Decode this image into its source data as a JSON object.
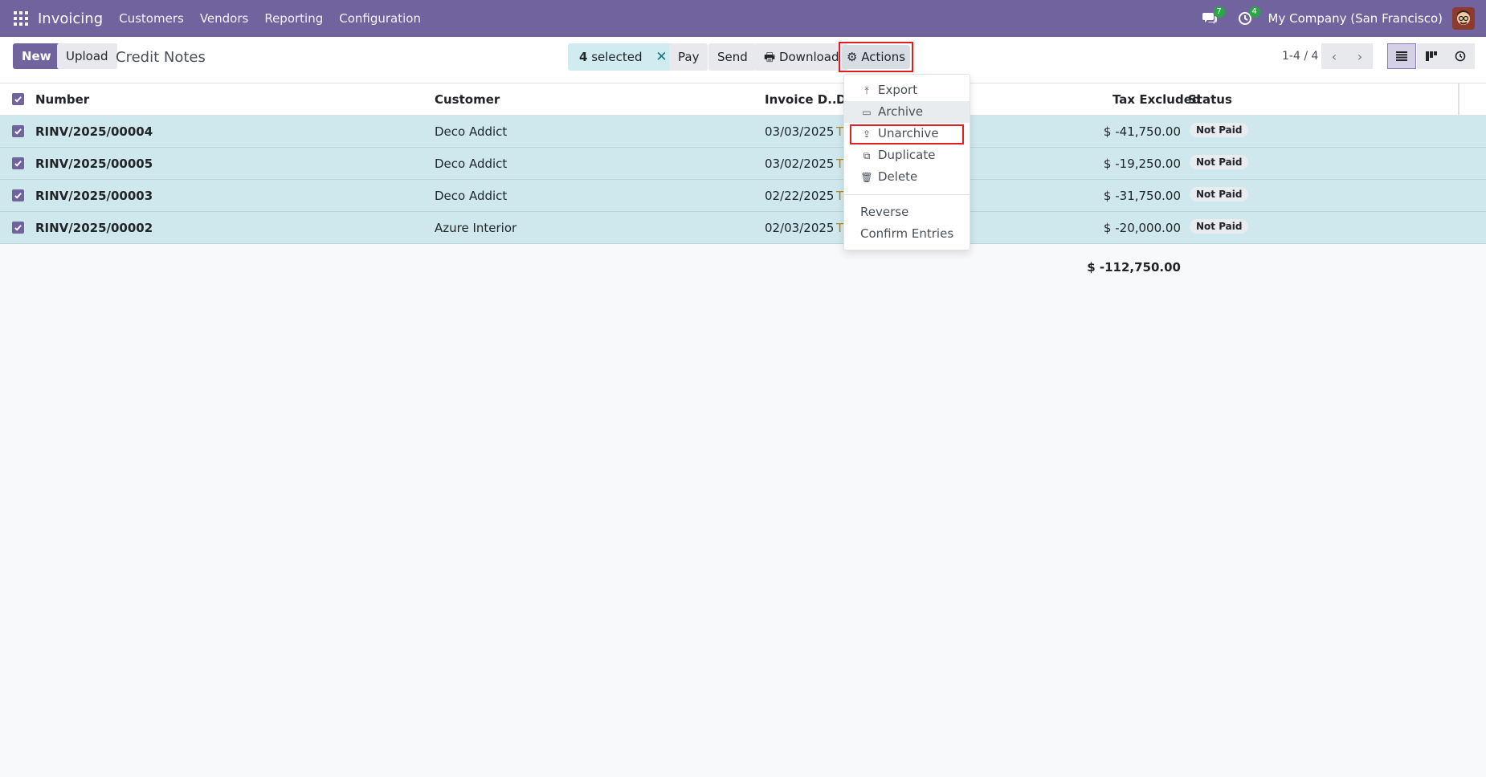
{
  "navbar": {
    "app_title": "Invoicing",
    "menu": [
      "Customers",
      "Vendors",
      "Reporting",
      "Configuration"
    ],
    "messages_count": "7",
    "activities_count": "4",
    "company": "My Company (San Francisco)"
  },
  "control": {
    "new_label": "New",
    "upload_label": "Upload",
    "breadcrumb": "Credit Notes",
    "selected_count": "4",
    "selected_label": "selected",
    "pay_label": "Pay",
    "send_label": "Send",
    "download_label": "Download",
    "actions_label": "Actions",
    "pager": "1-4 / 4"
  },
  "table": {
    "headers": {
      "number": "Number",
      "customer": "Customer",
      "invoice_date": "Invoice D...",
      "due": "D",
      "tax_excluded": "Tax Excluded",
      "status": "Status"
    },
    "rows": [
      {
        "number": "RINV/2025/00004",
        "customer": "Deco Addict",
        "date": "03/03/2025",
        "due": "T",
        "amount": "$ -41,750.00",
        "status": "Not Paid"
      },
      {
        "number": "RINV/2025/00005",
        "customer": "Deco Addict",
        "date": "03/02/2025",
        "due": "T",
        "amount": "$ -19,250.00",
        "status": "Not Paid"
      },
      {
        "number": "RINV/2025/00003",
        "customer": "Deco Addict",
        "date": "02/22/2025",
        "due": "T",
        "amount": "$ -31,750.00",
        "status": "Not Paid"
      },
      {
        "number": "RINV/2025/00002",
        "customer": "Azure Interior",
        "date": "02/03/2025",
        "due": "T",
        "amount": "$ -20,000.00",
        "status": "Not Paid"
      }
    ],
    "total": "$ -112,750.00"
  },
  "actions_menu": {
    "export": "Export",
    "archive": "Archive",
    "unarchive": "Unarchive",
    "duplicate": "Duplicate",
    "delete": "Delete",
    "reverse": "Reverse",
    "confirm_entries": "Confirm Entries"
  },
  "colors": {
    "brand": "#71639e",
    "selected_row": "#cfe8ee",
    "highlight": "#e02020"
  }
}
